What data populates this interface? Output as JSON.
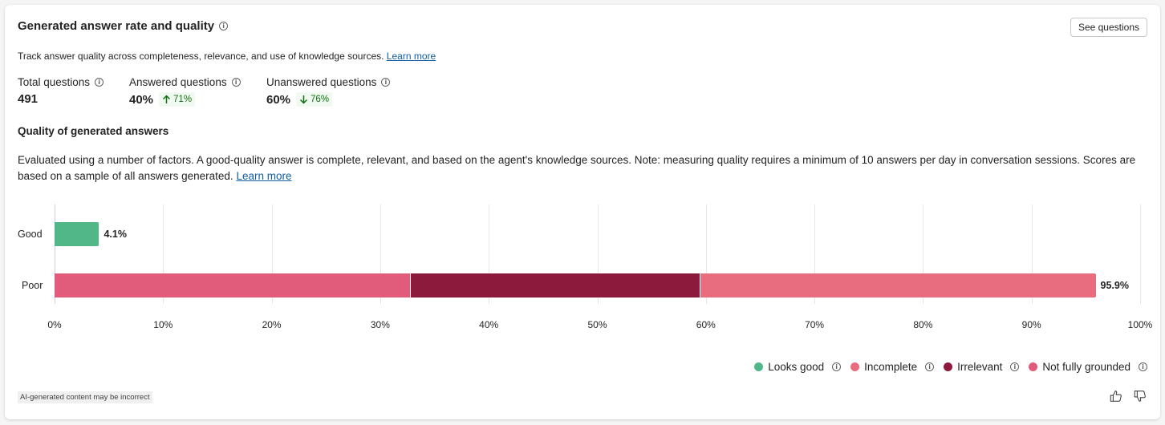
{
  "header": {
    "title": "Generated answer rate and quality",
    "see_questions": "See questions",
    "description": "Track answer quality across completeness, relevance, and use of knowledge sources.",
    "learn_more": "Learn more"
  },
  "metrics": [
    {
      "label": "Total questions",
      "value": "491",
      "delta": null
    },
    {
      "label": "Answered questions",
      "value": "40%",
      "delta": {
        "text": "71%",
        "direction": "up",
        "color": "#0e700e"
      }
    },
    {
      "label": "Unanswered questions",
      "value": "60%",
      "delta": {
        "text": "76%",
        "direction": "down",
        "color": "#0e700e"
      }
    }
  ],
  "quality": {
    "title": "Quality of generated answers",
    "description": "Evaluated using a number of factors. A good-quality answer is complete, relevant, and based on the agent's knowledge sources. Note: measuring quality requires a minimum of 10 answers per day in conversation sessions. Scores are based on a sample of all answers generated.",
    "learn_more": "Learn more"
  },
  "chart_data": {
    "type": "bar",
    "orientation": "horizontal",
    "stacked": true,
    "categories": [
      "Good",
      "Poor"
    ],
    "series": [
      {
        "name": "Looks good",
        "color": "#52b788",
        "values": [
          4.1,
          0
        ]
      },
      {
        "name": "Not fully grounded",
        "color": "#e05c7a",
        "values": [
          0,
          32.8
        ]
      },
      {
        "name": "Irrelevant",
        "color": "#8c1a3c",
        "values": [
          0,
          26.7
        ]
      },
      {
        "name": "Incomplete",
        "color": "#e86d7e",
        "values": [
          0,
          36.4
        ]
      }
    ],
    "totals": [
      {
        "category": "Good",
        "label": "4.1%"
      },
      {
        "category": "Poor",
        "label": "95.9%"
      }
    ],
    "xlim": [
      0,
      100
    ],
    "x_ticks": [
      "0%",
      "10%",
      "20%",
      "30%",
      "40%",
      "50%",
      "60%",
      "70%",
      "80%",
      "90%",
      "100%"
    ],
    "grid": true,
    "legend_position": "bottom-right",
    "legend": [
      {
        "name": "Looks good",
        "color": "#52b788"
      },
      {
        "name": "Incomplete",
        "color": "#e86d7e"
      },
      {
        "name": "Irrelevant",
        "color": "#8c1a3c"
      },
      {
        "name": "Not fully grounded",
        "color": "#e05c7a"
      }
    ]
  },
  "footer": {
    "ai_note": "AI-generated content may be incorrect",
    "icons": [
      "thumbs-up-icon",
      "thumbs-down-icon"
    ]
  }
}
